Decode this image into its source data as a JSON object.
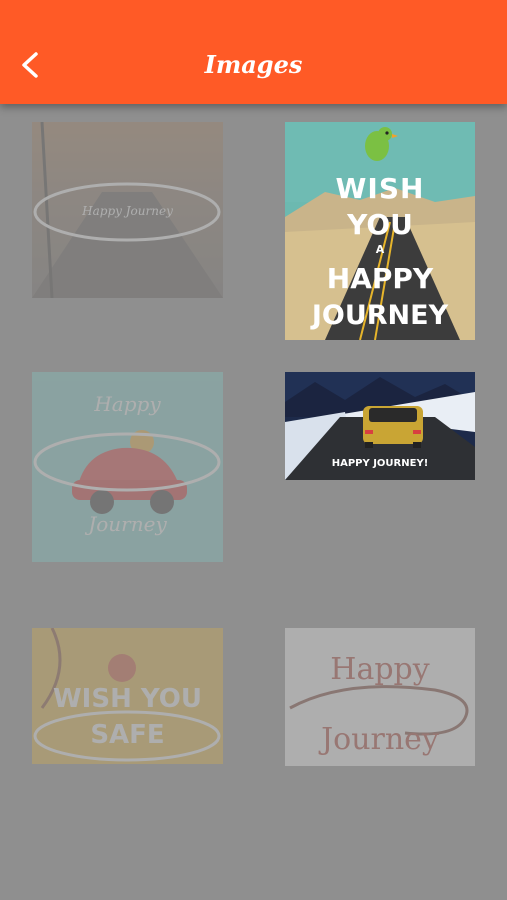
{
  "appbar": {
    "title": "Images",
    "back_icon": "chevron-left-icon",
    "background": "#ff5a26"
  },
  "grid": [
    {
      "id": "tile-1",
      "lines": [
        "Happy Journey"
      ],
      "active": false
    },
    {
      "id": "tile-2",
      "lines": [
        "WISH",
        "YOU",
        "A",
        "HAPPY",
        "JOURNEY"
      ],
      "active": true
    },
    {
      "id": "tile-3",
      "lines": [
        "Happy",
        "Journey"
      ],
      "active": false
    },
    {
      "id": "tile-4",
      "lines": [
        "HAPPY JOURNEY!"
      ],
      "active": true
    },
    {
      "id": "tile-5",
      "lines": [
        "WISH YOU",
        "SAFE"
      ],
      "active": false
    },
    {
      "id": "tile-6",
      "lines": [
        "Happy",
        "Journey"
      ],
      "active": false
    }
  ]
}
